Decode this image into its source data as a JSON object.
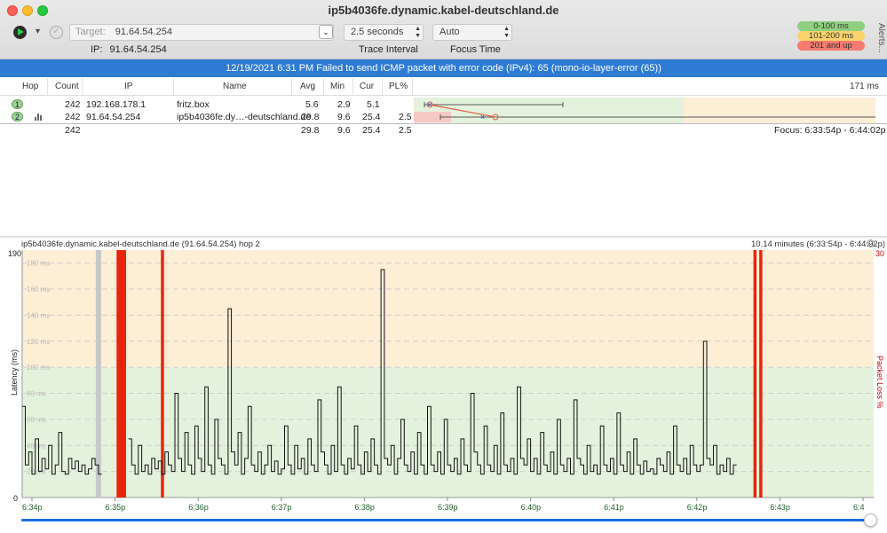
{
  "window": {
    "title": "ip5b4036fe.dynamic.kabel-deutschland.de"
  },
  "toolbar": {
    "target_label": "Target:",
    "target_value": "91.64.54.254",
    "interval_value": "2.5 seconds",
    "interval_label": "Trace Interval",
    "focus_value": "Auto",
    "focus_label": "Focus Time",
    "ip_label": "IP:",
    "ip_value": "91.64.54.254",
    "legend": [
      {
        "label": "0-100 ms",
        "color": "#8fd07e"
      },
      {
        "label": "101-200 ms",
        "color": "#f9d36b"
      },
      {
        "label": "201 and up",
        "color": "#f47b6e"
      }
    ],
    "alerts_label": "Alerts..."
  },
  "banner": {
    "text": "12/19/2021 6:31 PM Failed to send ICMP packet with error code (IPv4): 65 (mono-io-layer-error (65))"
  },
  "table": {
    "headers": {
      "hop": "Hop",
      "count": "Count",
      "ip": "IP",
      "name": "Name",
      "avg": "Avg",
      "min": "Min",
      "cur": "Cur",
      "pl": "PL%",
      "scale": "171 ms"
    },
    "rows": [
      {
        "hop": "1",
        "count": "242",
        "ip": "192.168.178.1",
        "name": "fritz.box",
        "avg": "5.6",
        "min": "2.9",
        "cur": "5.1",
        "pl": ""
      },
      {
        "hop": "2",
        "count": "242",
        "ip": "91.64.54.254",
        "name": "ip5b4036fe.dy…-deutschland.de",
        "avg": "29.8",
        "min": "9.6",
        "cur": "25.4",
        "pl": "2.5"
      }
    ],
    "summary": {
      "count": "242",
      "avg": "29.8",
      "min": "9.6",
      "cur": "25.4",
      "pl": "2.5",
      "focus": "Focus: 6:33:54p - 6:44:02p"
    }
  },
  "graph": {
    "title": "ip5b4036fe.dynamic.kabel-deutschland.de (91.64.54.254) hop 2",
    "range": "10.14 minutes (6:33:54p - 6:44:02p)",
    "y_axis_label": "Latency (ms)",
    "y2_axis_label": "Packet Loss %",
    "y_max_label": "190",
    "y_min_label": "0",
    "y2_max_label": "30",
    "grid_labels": [
      "180 ms",
      "160 ms",
      "140 ms",
      "120 ms",
      "100 ms",
      "80 ms",
      "60 ms",
      "40 ms",
      "20 ms"
    ],
    "x_labels": [
      "6:34p",
      "6:35p",
      "6:36p",
      "6:37p",
      "6:38p",
      "6:39p",
      "6:40p",
      "6:41p",
      "6:42p",
      "6:43p",
      "6:4"
    ]
  },
  "chart_data": {
    "type": "line",
    "title": "ip5b4036fe.dynamic.kabel-deutschland.de (91.64.54.254) hop 2",
    "xlabel": "",
    "ylabel": "Latency (ms)",
    "y2label": "Packet Loss %",
    "ylim": [
      0,
      190
    ],
    "y2lim": [
      0,
      30
    ],
    "x_tick_labels": [
      "6:34p",
      "6:35p",
      "6:36p",
      "6:37p",
      "6:38p",
      "6:39p",
      "6:40p",
      "6:41p",
      "6:42p",
      "6:43p",
      "6:4"
    ],
    "bands": [
      {
        "from": 0,
        "to": 100,
        "color": "#e3f2dc"
      },
      {
        "from": 100,
        "to": 190,
        "color": "#fdeed6"
      }
    ],
    "packet_loss_minutes": [
      1.05,
      1.1,
      1.57,
      8.7,
      8.77
    ],
    "gap_minutes": [
      0.8
    ],
    "latency_minutes_from_634": [
      -0.12,
      -0.08,
      -0.04,
      0,
      0.04,
      0.08,
      0.12,
      0.16,
      0.2,
      0.24,
      0.28,
      0.32,
      0.36,
      0.4,
      0.44,
      0.48,
      0.52,
      0.56,
      0.6,
      0.64,
      0.68,
      0.72,
      0.76,
      0.8,
      0.84,
      0.88,
      0.92,
      0.96,
      1.0,
      1.04,
      1.08,
      1.12,
      1.16,
      1.2,
      1.24,
      1.28,
      1.32,
      1.36,
      1.4,
      1.44,
      1.48,
      1.52,
      1.56,
      1.6,
      1.64,
      1.68,
      1.72,
      1.76,
      1.8,
      1.84,
      1.88,
      1.92,
      1.96,
      2.0,
      2.04,
      2.08,
      2.12,
      2.16,
      2.2,
      2.24,
      2.28,
      2.32,
      2.36,
      2.4,
      2.44,
      2.48,
      2.52,
      2.56,
      2.6,
      2.64,
      2.68,
      2.72,
      2.76,
      2.8,
      2.84,
      2.88,
      2.92,
      2.96,
      3.0,
      3.04,
      3.08,
      3.12,
      3.16,
      3.2,
      3.24,
      3.28,
      3.32,
      3.36,
      3.4,
      3.44,
      3.48,
      3.52,
      3.56,
      3.6,
      3.64,
      3.68,
      3.72,
      3.76,
      3.8,
      3.84,
      3.88,
      3.92,
      3.96,
      4.0,
      4.04,
      4.08,
      4.12,
      4.16,
      4.2,
      4.24,
      4.28,
      4.32,
      4.36,
      4.4,
      4.44,
      4.48,
      4.52,
      4.56,
      4.6,
      4.64,
      4.68,
      4.72,
      4.76,
      4.8,
      4.84,
      4.88,
      4.92,
      4.96,
      5.0,
      5.04,
      5.08,
      5.12,
      5.16,
      5.2,
      5.24,
      5.28,
      5.32,
      5.36,
      5.4,
      5.44,
      5.48,
      5.52,
      5.56,
      5.6,
      5.64,
      5.68,
      5.72,
      5.76,
      5.8,
      5.84,
      5.88,
      5.92,
      5.96,
      6.0,
      6.04,
      6.08,
      6.12,
      6.16,
      6.2,
      6.24,
      6.28,
      6.32,
      6.36,
      6.4,
      6.44,
      6.48,
      6.52,
      6.56,
      6.6,
      6.64,
      6.68,
      6.72,
      6.76,
      6.8,
      6.84,
      6.88,
      6.92,
      6.96,
      7.0,
      7.04,
      7.08,
      7.12,
      7.16,
      7.2,
      7.24,
      7.28,
      7.32,
      7.36,
      7.4,
      7.44,
      7.48,
      7.52,
      7.56,
      7.6,
      7.64,
      7.68,
      7.72,
      7.76,
      7.8,
      7.84,
      7.88,
      7.92,
      7.96,
      8.0,
      8.04,
      8.08,
      8.12,
      8.16,
      8.2,
      8.24,
      8.28,
      8.32,
      8.36,
      8.4,
      8.44,
      8.48,
      8.52,
      8.56,
      8.6,
      8.64,
      8.68,
      8.72,
      8.76,
      8.8,
      8.84,
      8.88,
      8.92,
      8.96,
      9.0,
      9.04,
      9.08,
      9.12,
      9.16,
      9.2,
      9.24,
      9.28,
      9.32,
      9.36,
      9.4,
      9.44,
      9.48,
      9.52,
      9.56,
      9.6,
      9.64,
      9.68,
      9.72,
      9.76,
      9.8,
      9.84,
      9.88,
      9.92,
      9.96,
      10.0
    ],
    "latency_ms": [
      70,
      25,
      35,
      18,
      45,
      20,
      30,
      22,
      40,
      18,
      25,
      50,
      20,
      18,
      30,
      22,
      28,
      20,
      25,
      18,
      22,
      30,
      25,
      18,
      null,
      null,
      null,
      null,
      null,
      null,
      null,
      null,
      45,
      25,
      18,
      40,
      20,
      25,
      18,
      30,
      22,
      28,
      18,
      35,
      25,
      20,
      80,
      30,
      20,
      50,
      25,
      18,
      55,
      30,
      20,
      85,
      25,
      18,
      60,
      30,
      25,
      18,
      145,
      35,
      25,
      50,
      18,
      30,
      70,
      25,
      20,
      35,
      18,
      25,
      40,
      20,
      28,
      18,
      22,
      55,
      25,
      18,
      40,
      22,
      30,
      18,
      45,
      25,
      20,
      75,
      35,
      25,
      18,
      40,
      20,
      85,
      25,
      18,
      30,
      22,
      55,
      25,
      18,
      35,
      20,
      45,
      25,
      18,
      175,
      30,
      25,
      40,
      18,
      30,
      60,
      25,
      20,
      35,
      18,
      50,
      25,
      18,
      70,
      25,
      20,
      35,
      18,
      60,
      25,
      20,
      30,
      18,
      45,
      25,
      20,
      80,
      35,
      25,
      18,
      55,
      25,
      20,
      40,
      18,
      65,
      25,
      20,
      30,
      18,
      85,
      30,
      25,
      45,
      20,
      30,
      18,
      50,
      25,
      20,
      35,
      18,
      60,
      25,
      20,
      30,
      18,
      75,
      30,
      25,
      18,
      40,
      20,
      25,
      18,
      55,
      25,
      20,
      30,
      18,
      65,
      25,
      20,
      35,
      18,
      45,
      25,
      18,
      28,
      20,
      22,
      18,
      30,
      25,
      20,
      35,
      18,
      55,
      25,
      20,
      30,
      18,
      40,
      25,
      20,
      25,
      120,
      30,
      25,
      40,
      18,
      25,
      20,
      30,
      18,
      25
    ]
  }
}
